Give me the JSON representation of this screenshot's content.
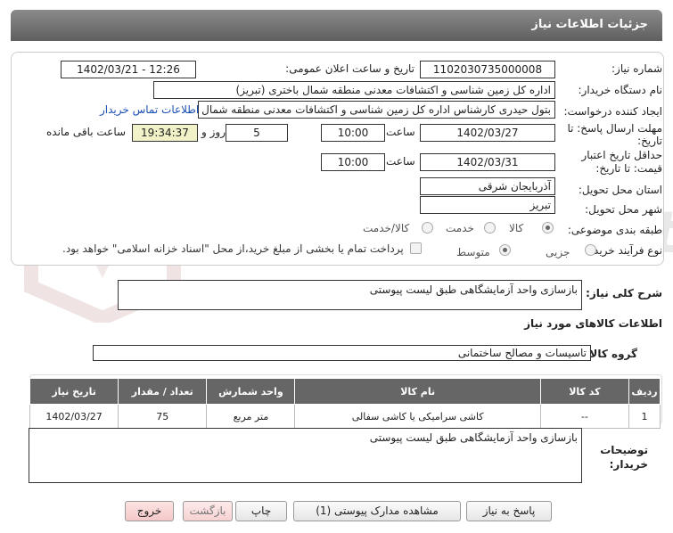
{
  "header": {
    "title": "جزئیات اطلاعات نیاز"
  },
  "watermark": {
    "text": "AriaTender.net"
  },
  "form": {
    "need_number_label": "شماره نیاز:",
    "need_number": "1102030735000008",
    "announce_label": "تاریخ و ساعت اعلان عمومی:",
    "announce_value": "1402/03/21 - 12:26",
    "buyer_org_label": "نام دستگاه خریدار:",
    "buyer_org": "اداره کل زمین شناسی و اکتشافات معدنی منطقه شمال باختری (تبریز)",
    "requester_label": "ایجاد کننده درخواست:",
    "requester": "بتول  حیدری کارشناس اداره کل زمین شناسی و اکتشافات معدنی منطقه شمال",
    "contact_link": "اطلاعات تماس خریدار",
    "reply_deadline_label_1": "مهلت ارسال پاسخ: تا",
    "reply_deadline_label_2": "تاریخ:",
    "reply_date": "1402/03/27",
    "time_label": "ساعت",
    "reply_time": "10:00",
    "days_value": "5",
    "days_label": "روز و",
    "remaining_time": "19:34:37",
    "remaining_label": "ساعت باقی مانده",
    "validity_label_1": "حداقل تاریخ اعتبار",
    "validity_label_2": "قیمت: تا تاریخ:",
    "validity_date": "1402/03/31",
    "validity_time": "10:00",
    "province_label": "استان محل تحویل:",
    "province": "آذربایجان شرقی",
    "city_label": "شهر محل تحویل:",
    "city": "تبریز",
    "category_label": "طبقه بندی موضوعی:",
    "category_options": [
      "کالا",
      "خدمت",
      "کالا/خدمت"
    ],
    "process_label": "نوع فرآیند خرید :",
    "process_options": [
      "جزیی",
      "متوسط"
    ],
    "payment_note": "پرداخت تمام یا بخشی از مبلغ خرید،از محل \"اسناد خزانه اسلامی\" خواهد بود."
  },
  "description": {
    "label": "شرح کلی نیاز:",
    "value": "بازسازی واحد آزمایشگاهی طبق لیست پیوستی"
  },
  "goods": {
    "section_title": "اطلاعات کالاهای مورد نیاز",
    "group_label": "گروه کالا:",
    "group_value": "تاسیسات و مصالح ساختمانی",
    "columns": [
      "ردیف",
      "کد کالا",
      "نام کالا",
      "واحد شمارش",
      "تعداد / مقدار",
      "تاریخ نیاز"
    ],
    "rows": [
      [
        "1",
        "--",
        "کاشی سرامیکی یا کاشی سفالی",
        "متر مربع",
        "75",
        "1402/03/27"
      ]
    ]
  },
  "buyer_notes": {
    "label_1": "توضیحات",
    "label_2": "خریدار:",
    "value": "بازسازی واحد آزمایشگاهی طبق لیست پیوستی"
  },
  "buttons": {
    "reply": "پاسخ به نیاز",
    "view_docs": "مشاهده مدارک پیوستی (1)",
    "print": "چاپ",
    "back": "بازگشت",
    "exit": "خروج"
  }
}
